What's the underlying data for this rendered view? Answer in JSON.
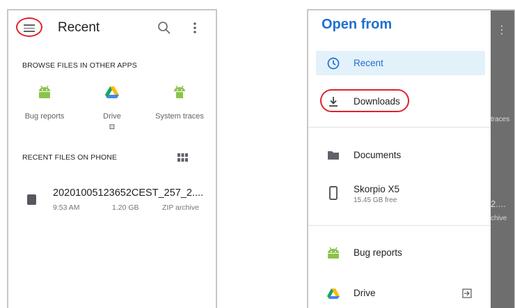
{
  "left_screen": {
    "toolbar": {
      "title": "Recent",
      "menu_icon": "menu-icon",
      "search_icon": "search-icon",
      "more_icon": "more-vert-icon"
    },
    "browse_section": {
      "label": "BROWSE FILES IN OTHER APPS",
      "apps": [
        {
          "label": "Bug reports",
          "icon": "android-icon",
          "color": "#8bc34a"
        },
        {
          "label": "Drive",
          "icon": "drive-icon",
          "sub": "⊡"
        },
        {
          "label": "System traces",
          "icon": "android-icon",
          "color": "#8bc34a"
        }
      ]
    },
    "recent_section": {
      "label": "RECENT FILES ON PHONE",
      "view_toggle_icon": "grid-view-icon"
    },
    "files": [
      {
        "name": "20201005123652CEST_257_2....",
        "time": "9:53 AM",
        "size": "1.20 GB",
        "type": "ZIP archive"
      }
    ]
  },
  "right_screen": {
    "drawer": {
      "title": "Open from",
      "items": [
        {
          "label": "Recent",
          "icon": "clock-icon",
          "active": true
        },
        {
          "label": "Downloads",
          "icon": "download-icon"
        },
        {
          "label": "Documents",
          "icon": "folder-icon"
        },
        {
          "label": "Skorpio X5",
          "sub": "15.45 GB free",
          "icon": "phone-icon"
        },
        {
          "label": "Bug reports",
          "icon": "android-icon"
        },
        {
          "label": "Drive",
          "icon": "drive-icon"
        }
      ]
    },
    "background_fragments": {
      "traces": "traces",
      "file_part": "2....",
      "archive_part": "chive",
      "more": "⋮"
    }
  },
  "colors": {
    "accent": "#1f6fd0",
    "highlight": "#e0222a",
    "android": "#8bc34a",
    "active_bg": "#e3f1fb"
  }
}
